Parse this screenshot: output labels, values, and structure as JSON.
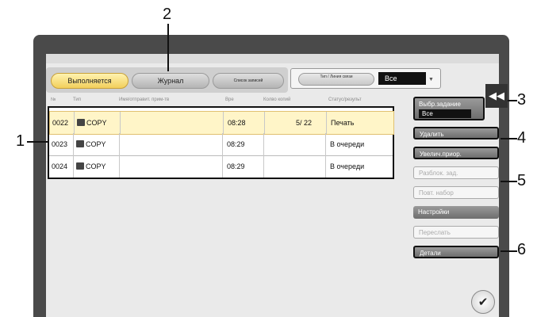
{
  "tabs": [
    {
      "label": "Выполняется",
      "active": true
    },
    {
      "label": "Журнал",
      "active": false
    },
    {
      "label": "Список записей",
      "active": false
    }
  ],
  "filter": {
    "label": "Тип / Линия связи",
    "value": "Все"
  },
  "table": {
    "columns": [
      "№",
      "Тип",
      "Имя/отправит. прим-тв",
      "Вре",
      "Колво копий",
      "Статус/результ"
    ],
    "rows": [
      {
        "no": "0022",
        "type": "COPY",
        "time": "08:28",
        "copies": "5/  22",
        "status": "Печать",
        "selected": true
      },
      {
        "no": "0023",
        "type": "COPY",
        "time": "08:29",
        "copies": "",
        "status": "В очереди",
        "selected": false
      },
      {
        "no": "0024",
        "type": "COPY",
        "time": "08:29",
        "copies": "",
        "status": "В очереди",
        "selected": false
      }
    ]
  },
  "job_select": {
    "label": "Выбр.задание",
    "value": "Все"
  },
  "buttons": {
    "delete": "Удалить",
    "raise_priority": "Увелич.приор.",
    "release": "Разблок. зад.",
    "reprint": "Повт. набор",
    "settings": "Настройки",
    "forward": "Переслать",
    "details": "Детали"
  },
  "callouts": [
    "1",
    "2",
    "3",
    "4",
    "5",
    "6"
  ],
  "colors": {
    "selected_row": "#fff5c8",
    "active_tab": "#f2cf5c",
    "button": "#7e7e7e"
  }
}
